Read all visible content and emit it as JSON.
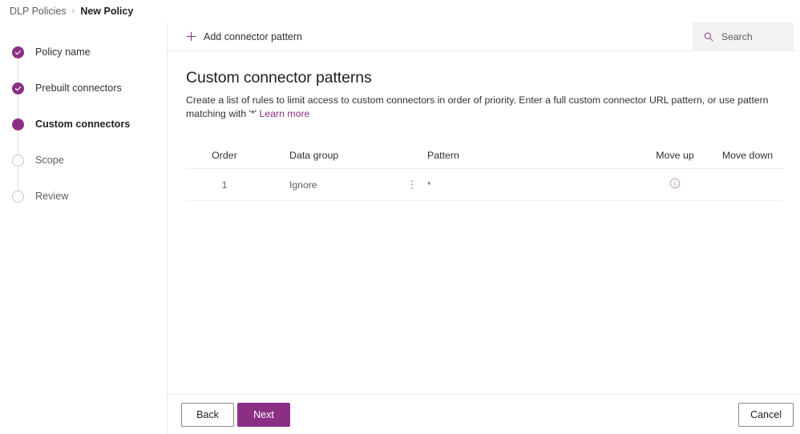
{
  "breadcrumb": {
    "parent": "DLP Policies",
    "separator": "›",
    "current": "New Policy"
  },
  "sidebar": {
    "steps": [
      {
        "label": "Policy name",
        "state": "done"
      },
      {
        "label": "Prebuilt connectors",
        "state": "done"
      },
      {
        "label": "Custom connectors",
        "state": "current"
      },
      {
        "label": "Scope",
        "state": "pending"
      },
      {
        "label": "Review",
        "state": "pending"
      }
    ]
  },
  "toolbar": {
    "add_label": "Add connector pattern",
    "add_icon": "plus-icon"
  },
  "search": {
    "placeholder": "Search",
    "value": "",
    "icon": "search-icon"
  },
  "main": {
    "heading": "Custom connector patterns",
    "description_part1": "Create a list of rules to limit access to custom connectors in order of priority. Enter a full custom connector URL pattern, or use pattern matching with '*' ",
    "description_link": "Learn more"
  },
  "table": {
    "columns": [
      "Order",
      "Data group",
      "Pattern",
      "Move up",
      "Move down"
    ],
    "rows": [
      {
        "order": "1",
        "data_group": "Ignore",
        "pattern": "*",
        "move_up_icon": "info-circle-icon",
        "move_down": ""
      }
    ]
  },
  "footer": {
    "back_label": "Back",
    "next_label": "Next",
    "cancel_label": "Cancel"
  },
  "colors": {
    "accent": "#8a2f84",
    "text_primary": "#201f1e",
    "text_secondary": "#605e5c",
    "border": "#edebe9",
    "search_bg": "#f3f2f1"
  }
}
